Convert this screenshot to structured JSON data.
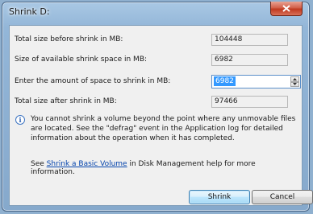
{
  "window": {
    "title": "Shrink D:"
  },
  "fields": {
    "total_before_label": "Total size before shrink in MB:",
    "total_before_value": "104448",
    "available_label": "Size of available shrink space in MB:",
    "available_value": "6982",
    "amount_label": "Enter the amount of space to shrink in MB:",
    "amount_value": "6982",
    "total_after_label": "Total size after shrink in MB:",
    "total_after_value": "97466"
  },
  "notice": {
    "icon": "info-icon",
    "text": "You cannot shrink a volume beyond the point where any unmovable files are located. See the \"defrag\" event in the Application log for detailed information about the operation when it has completed."
  },
  "help": {
    "prefix": "See ",
    "link": "Shrink a Basic Volume",
    "suffix": " in Disk Management help for more information."
  },
  "buttons": {
    "shrink": "Shrink",
    "cancel": "Cancel"
  }
}
